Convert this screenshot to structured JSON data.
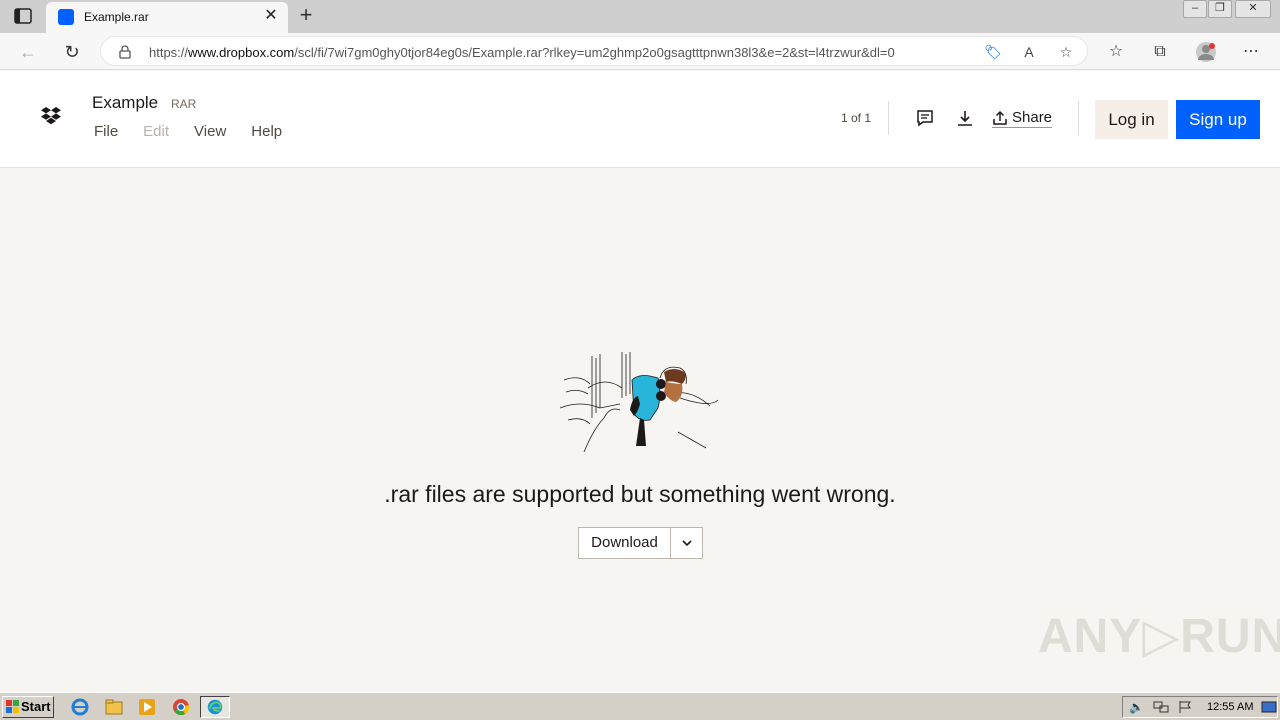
{
  "browser": {
    "tab_title": "Example.rar",
    "url_prefix": "https://",
    "url_domain": "www.dropbox.com",
    "url_path": "/scl/fi/7wi7gm0ghy0tjor84eg0s/Example.rar?rlkey=um2ghmp2o0gsagtttpnwn38l3&e=2&st=l4trzwur&dl=0"
  },
  "header": {
    "file_name": "Example",
    "file_ext": "RAR",
    "menu": [
      "File",
      "Edit",
      "View",
      "Help"
    ],
    "page_count": "1 of 1",
    "share_label": "Share",
    "login_label": "Log in",
    "signup_label": "Sign up"
  },
  "main": {
    "error_message": ".rar files are supported but something went wrong.",
    "download_label": "Download"
  },
  "watermark": "ANY▷RUN",
  "taskbar": {
    "start_label": "Start",
    "clock": "12:55 AM"
  },
  "colors": {
    "brand_blue": "#0061fe",
    "background": "#f7f5f2",
    "login_bg": "#f5efe7"
  }
}
